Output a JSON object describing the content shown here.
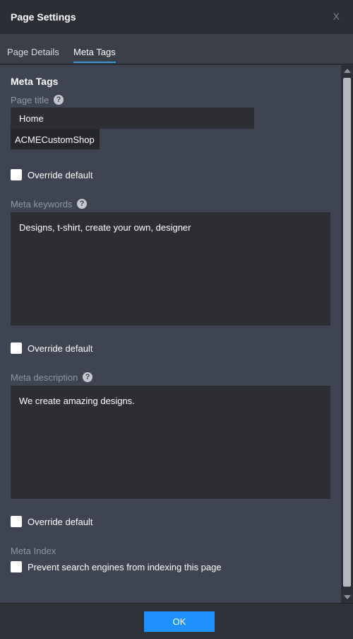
{
  "header": {
    "title": "Page Settings",
    "close_label": "X"
  },
  "tabs": [
    {
      "label": "Page Details",
      "active": false
    },
    {
      "label": "Meta Tags",
      "active": true
    }
  ],
  "meta": {
    "section_title": "Meta Tags",
    "page_title": {
      "label": "Page title",
      "value": "Home",
      "suffix": "ACMECustomShop"
    },
    "override_label": "Override default",
    "keywords": {
      "label": "Meta keywords",
      "value": "Designs, t-shirt, create your own, designer"
    },
    "description": {
      "label": "Meta description",
      "value": "We create amazing designs."
    },
    "index": {
      "label": "Meta Index",
      "prevent_label": "Prevent search engines from indexing this page"
    },
    "help_glyph": "?"
  },
  "footer": {
    "ok_label": "OK"
  },
  "colors": {
    "accent": "#1e90ff",
    "tab_underline": "#3b9ae1",
    "panel": "#3e4451",
    "field": "#2c2e33"
  }
}
